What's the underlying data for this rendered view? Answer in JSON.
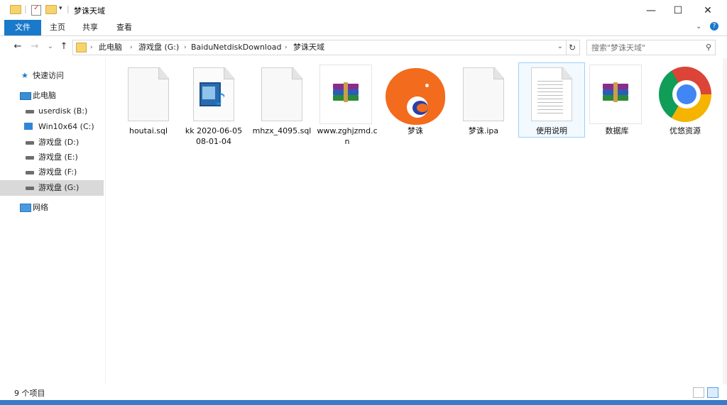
{
  "window": {
    "title": "梦诛天域",
    "minimize": "—",
    "maximize": "☐",
    "close": "✕"
  },
  "ribbon": {
    "tabs": [
      "文件",
      "主页",
      "共享",
      "查看"
    ],
    "expand": "⌄",
    "help": "?"
  },
  "nav": {
    "back": "←",
    "forward": "→",
    "recent": "⌄",
    "up": "↑"
  },
  "address": {
    "crumbs": [
      "此电脑",
      "游戏盘 (G:)",
      "BaiduNetdiskDownload",
      "梦诛天域"
    ],
    "dropdown": "⌄",
    "refresh": "↻"
  },
  "search": {
    "placeholder": "搜索\"梦诛天域\""
  },
  "sidebar": {
    "quick_access": "快速访问",
    "this_pc": "此电脑",
    "drives": [
      "userdisk (B:)",
      "Win10x64 (C:)",
      "游戏盘 (D:)",
      "游戏盘 (E:)",
      "游戏盘 (F:)",
      "游戏盘 (G:)"
    ],
    "selected_drive": "游戏盘 (G:)",
    "network": "网络"
  },
  "files": [
    {
      "name": "houtai.sql",
      "icon": "blank-file-icon"
    },
    {
      "name": "kk 2020-06-05 08-01-04",
      "icon": "media-file-icon"
    },
    {
      "name": "mhzx_4095.sql",
      "icon": "blank-file-icon"
    },
    {
      "name": "www.zghjzmd.cn",
      "icon": "winrar-archive-icon"
    },
    {
      "name": "梦诛",
      "icon": "orange-fish-logo-icon"
    },
    {
      "name": "梦诛.ipa",
      "icon": "blank-file-icon"
    },
    {
      "name": "使用说明",
      "icon": "text-document-icon"
    },
    {
      "name": "数据库",
      "icon": "winrar-archive-icon"
    },
    {
      "name": "优悠资源",
      "icon": "chrome-icon"
    }
  ],
  "selected_file": "使用说明",
  "status": {
    "count": "9 个项目"
  },
  "colors": {
    "accent": "#1979ca",
    "folder": "#f5d36e",
    "selection": "#cce8ff"
  }
}
